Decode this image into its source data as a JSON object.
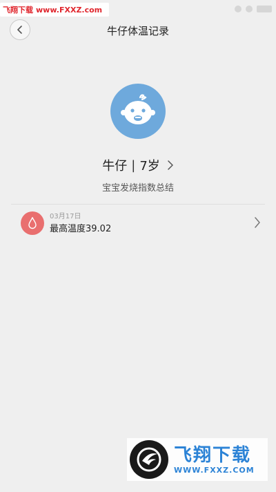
{
  "watermark_top": {
    "site_name": "飞翔下载",
    "url": "www.FXXZ.com"
  },
  "header": {
    "title": "牛仔体温记录",
    "back_icon": "chevron-left-icon"
  },
  "profile": {
    "avatar_icon": "baby-face-icon",
    "name": "牛仔",
    "separator": "|",
    "age": "7岁",
    "summary_link": "宝宝发烧指数总结"
  },
  "records": [
    {
      "icon": "droplet-icon",
      "date": "03月17日",
      "temperature_text": "最高温度39.02"
    }
  ],
  "watermark_bottom": {
    "brand": "飞翔下载",
    "url": "WWW.FXXZ.COM"
  },
  "colors": {
    "background": "#efefef",
    "avatar_bg": "#6ea9dc",
    "record_icon_bg": "#e96f6f",
    "watermark_red": "#e0262d",
    "watermark_blue": "#2c83d6"
  }
}
